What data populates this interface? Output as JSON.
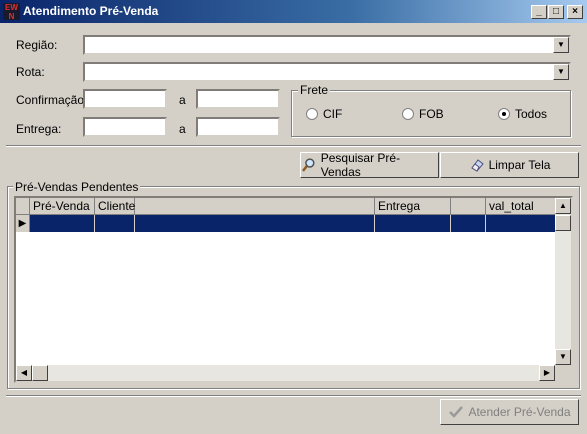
{
  "window": {
    "title": "Atendimento Pré-Venda",
    "minimize": "_",
    "maximize": "□",
    "close": "×"
  },
  "filters": {
    "regiao_label": "Região:",
    "rota_label": "Rota:",
    "confirmacao_label": "Confirmação:",
    "entrega_label": "Entrega:",
    "range_sep": "a"
  },
  "frete": {
    "title": "Frete",
    "options": [
      "CIF",
      "FOB",
      "Todos"
    ],
    "selected": "Todos"
  },
  "buttons": {
    "pesquisar": "Pesquisar Pré-Vendas",
    "limpar": "Limpar Tela",
    "atender": "Atender Pré-Venda"
  },
  "grid": {
    "title": "Pré-Vendas Pendentes",
    "columns": [
      "Pré-Venda",
      "Cliente",
      "",
      "Entrega",
      "",
      "val_total"
    ]
  },
  "icons": {
    "arrow_down": "▼",
    "arrow_up": "▲",
    "arrow_left": "◀",
    "arrow_right": "▶",
    "row_indicator": "▶"
  }
}
